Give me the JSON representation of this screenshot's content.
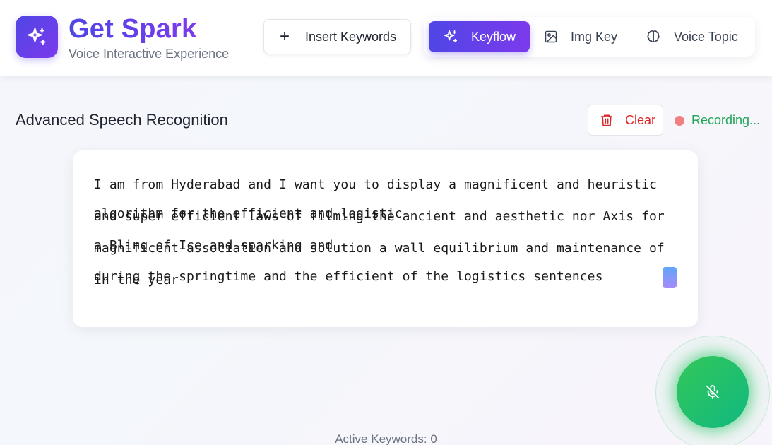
{
  "brand": {
    "title": "Get Spark",
    "subtitle": "Voice Interactive Experience",
    "logo_icon": "sparkles-icon"
  },
  "toolbar": {
    "insert_label": "Insert Keywords",
    "insert_icon": "plus-icon"
  },
  "modes": {
    "active": "Keyflow",
    "items": [
      {
        "label": "Keyflow",
        "icon": "sparkles-icon"
      },
      {
        "label": "Img Key",
        "icon": "image-icon"
      },
      {
        "label": "Voice Topic",
        "icon": "brain-icon"
      }
    ]
  },
  "section": {
    "title": "Advanced Speech Recognition",
    "clear_label": "Clear",
    "clear_icon": "trash-icon",
    "recording_label": "Recording..."
  },
  "transcript": {
    "lines": [
      "I am from Hyderabad and I want you to display a magnificent and heuristic",
      "algorithm for the efficient and logistic",
      "and super efficient laws of filming the ancient and aesthetic nor Axis for",
      "a Bling of Ice and sparking and",
      "magnificent association and solution a wall equilibrium and maintenance of",
      "during the springtime and the efficient of the logistics sentences",
      "in the year"
    ]
  },
  "mic": {
    "icon": "mic-off-icon"
  },
  "footer": {
    "active_keywords": "Active Keywords: 0"
  },
  "colors": {
    "accent_start": "#4f46e5",
    "accent_end": "#7c3aed",
    "danger": "#dc2626",
    "recording": "#22a55a",
    "mic_green": "#22c55e"
  }
}
